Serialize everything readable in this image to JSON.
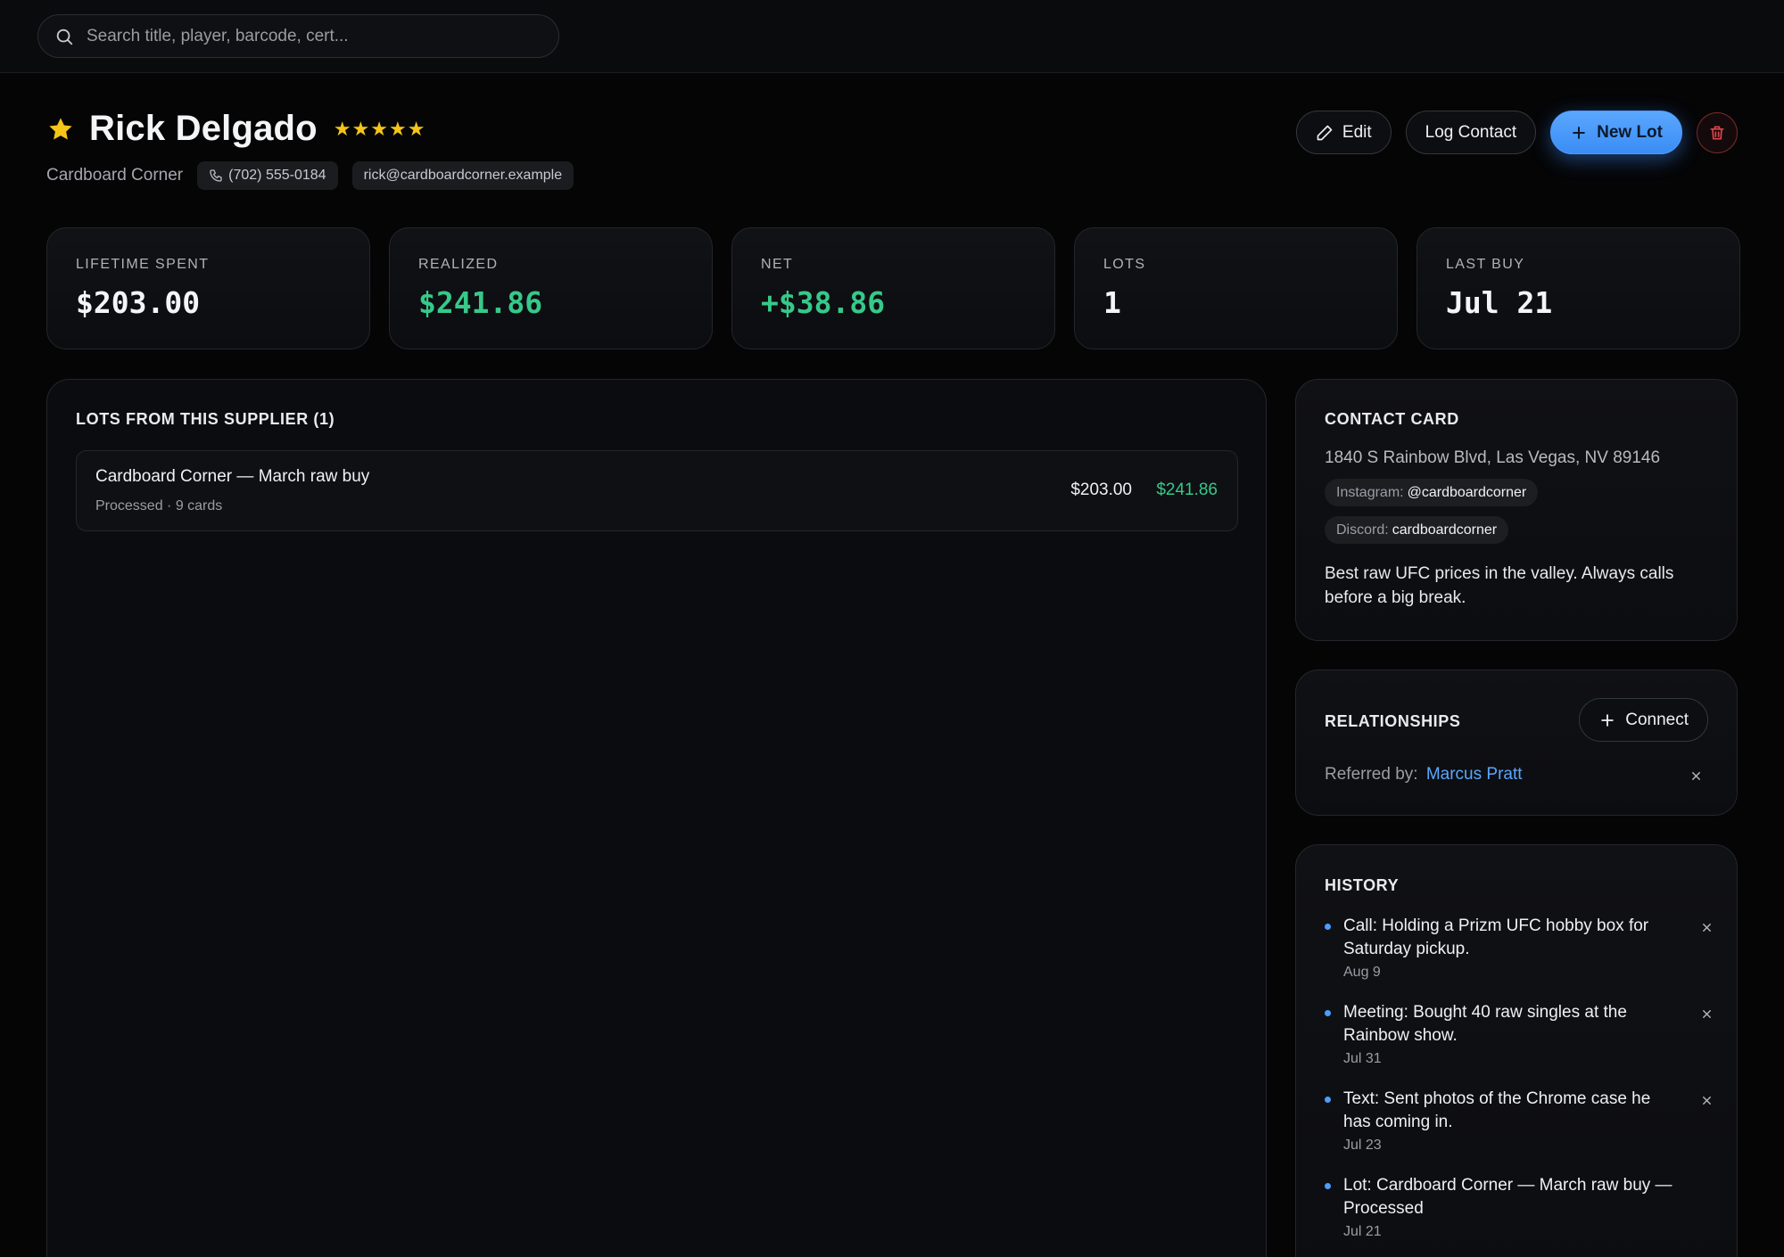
{
  "search": {
    "placeholder": "Search title, player, barcode, cert..."
  },
  "profile": {
    "name": "Rick Delgado",
    "rating": "★★★★★",
    "company": "Cardboard Corner",
    "phone": "(702) 555-0184",
    "email": "rick@cardboardcorner.example"
  },
  "actions": {
    "edit": "Edit",
    "log_contact": "Log Contact",
    "new_lot": "New Lot"
  },
  "stats": [
    {
      "label": "LIFETIME SPENT",
      "value": "$203.00"
    },
    {
      "label": "REALIZED",
      "value": "$241.86"
    },
    {
      "label": "NET",
      "value": "+$38.86"
    },
    {
      "label": "LOTS",
      "value": "1"
    },
    {
      "label": "LAST BUY",
      "value": "Jul 21"
    }
  ],
  "lots": {
    "title": "LOTS FROM THIS SUPPLIER (1)",
    "items": [
      {
        "name": "Cardboard Corner — March raw buy",
        "meta": "Processed · 9 cards",
        "cost": "$203.00",
        "realized": "$241.86"
      }
    ]
  },
  "contact_card": {
    "title": "CONTACT CARD",
    "address": "1840 S Rainbow Blvd, Las Vegas, NV 89146",
    "instagram_label": "Instagram:",
    "instagram": "@cardboardcorner",
    "discord_label": "Discord:",
    "discord": "cardboardcorner",
    "note": "Best raw UFC prices in the valley. Always calls before a big break."
  },
  "relationships": {
    "title": "RELATIONSHIPS",
    "connect": "Connect",
    "referred_label": "Referred by:",
    "referred_name": "Marcus Pratt"
  },
  "history": {
    "title": "HISTORY",
    "items": [
      {
        "text": "Call: Holding a Prizm UFC hobby box for Saturday pickup.",
        "date": "Aug 9"
      },
      {
        "text": "Meeting: Bought 40 raw singles at the Rainbow show.",
        "date": "Jul 31"
      },
      {
        "text": "Text: Sent photos of the Chrome case he has coming in.",
        "date": "Jul 23"
      },
      {
        "text": "Lot: Cardboard Corner — March raw buy — Processed",
        "date": "Jul 21"
      }
    ]
  },
  "colors": {
    "accent": "#4d9cff",
    "positive": "#36c98a",
    "star": "#f5c518",
    "danger": "#e0454a"
  }
}
